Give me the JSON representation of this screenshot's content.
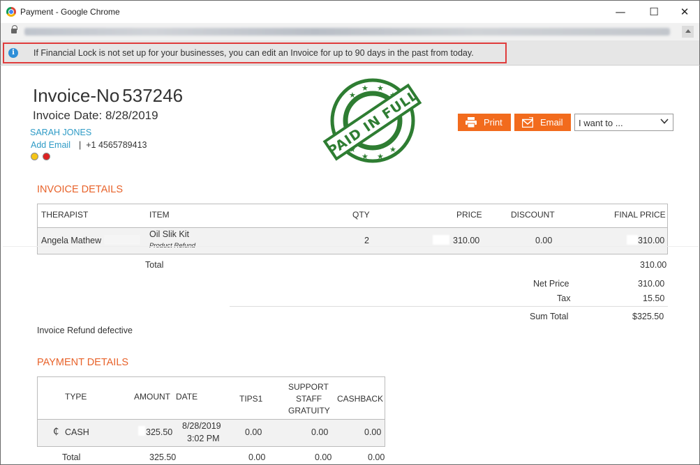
{
  "window": {
    "title": "Payment - Google Chrome"
  },
  "infobar": {
    "message": "If Financial Lock is not set up for your businesses, you can edit an Invoice for up to 90 days in the past from today."
  },
  "invoice": {
    "label": "Invoice-No",
    "number": "537246",
    "date_text": "Invoice Date: 8/28/2019",
    "client_name": "SARAH JONES",
    "add_email_label": "Add Email",
    "separator": "|",
    "phone": "+1 4565789413",
    "stamp_text": "PAID IN FULL"
  },
  "actions": {
    "print_label": "Print",
    "email_label": "Email",
    "iwant_label": "I want to ..."
  },
  "invoice_details": {
    "title": "INVOICE DETAILS",
    "headers": {
      "therapist": "THERAPIST",
      "item": "ITEM",
      "qty": "QTY",
      "price": "PRICE",
      "discount": "DISCOUNT",
      "final_price": "FINAL PRICE"
    },
    "row": {
      "therapist": "Angela Mathew",
      "item": "Oil Slik Kit",
      "item_note": "Product Refund",
      "qty": "2",
      "price": "310.00",
      "discount": "0.00",
      "final_price": "310.00"
    },
    "total_label": "Total",
    "total_value": "310.00",
    "net_price_label": "Net Price",
    "net_price_value": "310.00",
    "tax_label": "Tax",
    "tax_value": "15.50",
    "sum_total_label": "Sum Total",
    "sum_total_value": "$325.50"
  },
  "note": "Invoice Refund defective",
  "payment_details": {
    "title": "PAYMENT DETAILS",
    "headers": {
      "type": "TYPE",
      "amount": "AMOUNT",
      "date": "DATE",
      "tips": "TIPS1",
      "support_1": "SUPPORT",
      "support_2": "STAFF",
      "support_3": "GRATUITY",
      "cashback": "CASHBACK"
    },
    "row": {
      "type": "CASH",
      "amount": "325.50",
      "date": "8/28/2019",
      "time": "3:02 PM",
      "tips": "0.00",
      "support": "0.00",
      "cashback": "0.00"
    },
    "total": {
      "label": "Total",
      "amount": "325.50",
      "tips": "0.00",
      "support": "0.00",
      "cashback": "0.00"
    }
  },
  "colors": {
    "accent": "#f26b1d",
    "section_title": "#e8632b",
    "link": "#2e9bc6",
    "stamp": "#2e7d32",
    "highlight": "#e03c3c"
  }
}
